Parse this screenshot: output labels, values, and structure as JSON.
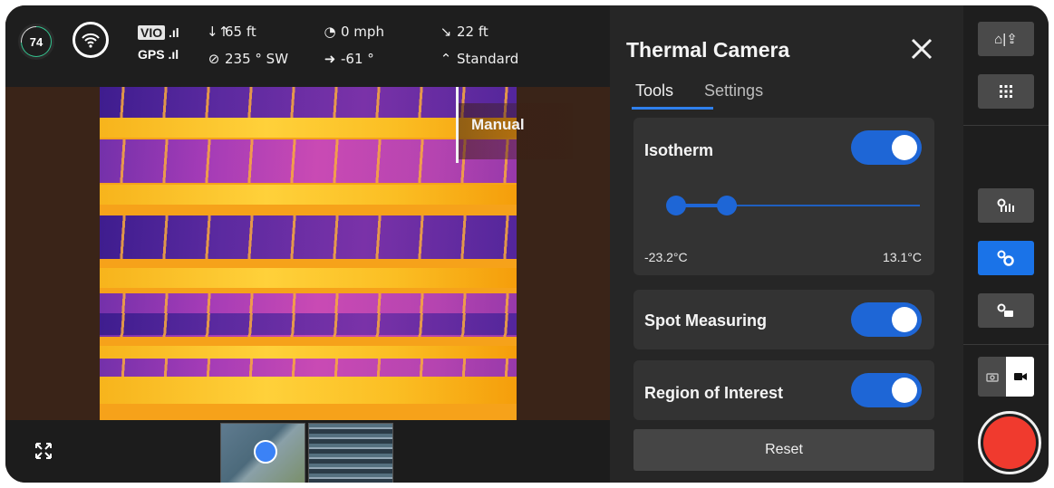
{
  "telemetry": {
    "battery": "74",
    "vio_label": "VIO",
    "gps_label": "GPS",
    "altitude": "65 ft",
    "heading": "235 ° SW",
    "speed": "0 mph",
    "gimbal": "-61 °",
    "distance": "22 ft",
    "mode": "Standard"
  },
  "camera": {
    "focus_label": "Manual"
  },
  "panel": {
    "title": "Thermal Camera",
    "tabs": [
      {
        "label": "Tools",
        "active": true
      },
      {
        "label": "Settings",
        "active": false
      }
    ],
    "isotherm": {
      "label": "Isotherm",
      "enabled": true,
      "min_value": "-23.2°C",
      "max_value": "13.1°C"
    },
    "spot_measuring": {
      "label": "Spot Measuring",
      "enabled": true
    },
    "region_of_interest": {
      "label": "Region of Interest",
      "enabled": true
    },
    "reset_label": "Reset"
  },
  "rail": {
    "home_label": "⌂|⇪",
    "active_tool": "spot-measure"
  },
  "colors": {
    "accent": "#1e66d6",
    "record": "#f03a2e",
    "battery_ring": "#34c38f"
  }
}
